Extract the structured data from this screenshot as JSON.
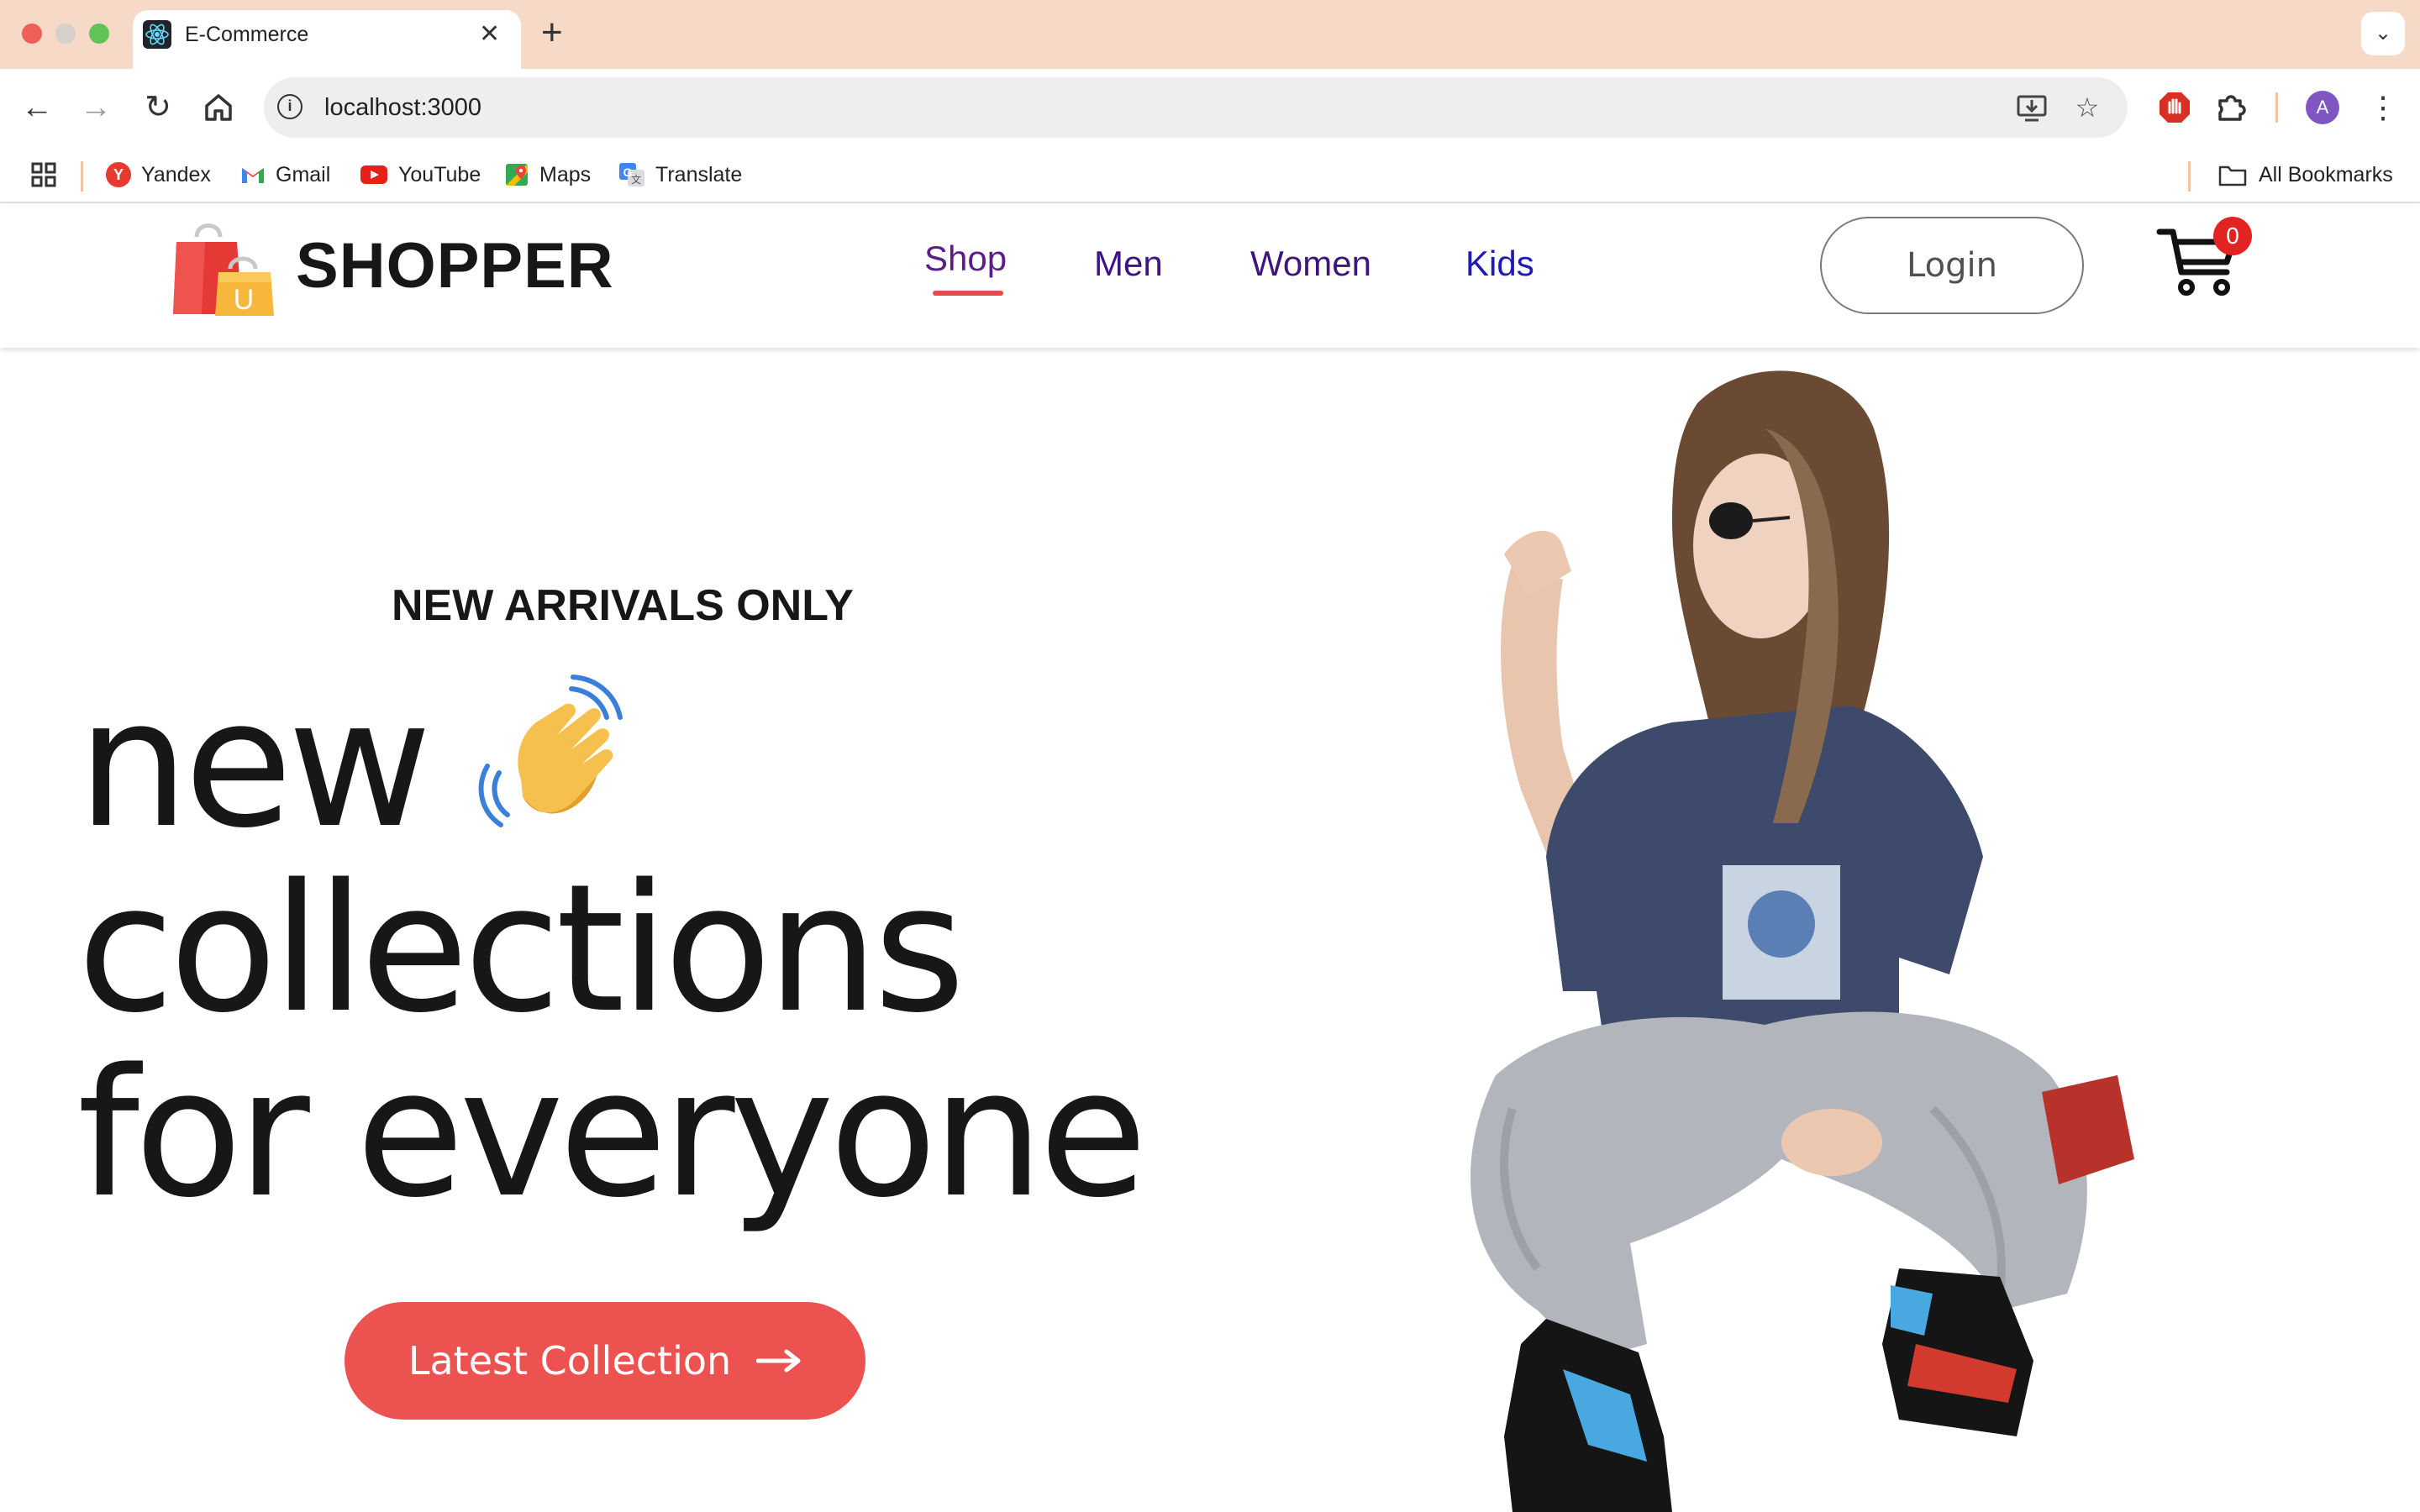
{
  "browser": {
    "tab_title": "E-Commerce",
    "tab_close": "✕",
    "new_tab": "+",
    "url": "localhost:3000",
    "bookmarks": [
      {
        "label": "Yandex",
        "icon": "yandex-icon",
        "color": "#e63a2e"
      },
      {
        "label": "Gmail",
        "icon": "gmail-icon",
        "color": "#ea4335"
      },
      {
        "label": "YouTube",
        "icon": "youtube-icon",
        "color": "#e62117"
      },
      {
        "label": "Maps",
        "icon": "maps-icon",
        "color": "#34a853"
      },
      {
        "label": "Translate",
        "icon": "translate-icon",
        "color": "#4285f4"
      }
    ],
    "all_bookmarks": "All Bookmarks",
    "avatar_letter": "A"
  },
  "site": {
    "logo_text": "SHOPPER",
    "menu": [
      {
        "label": "Shop",
        "active": true,
        "color": "#5b1d88"
      },
      {
        "label": "Men",
        "active": false,
        "color": "#3d1480"
      },
      {
        "label": "Women",
        "active": false,
        "color": "#3d1480"
      },
      {
        "label": "Kids",
        "active": false,
        "color": "#1e1ab3"
      }
    ],
    "login_label": "Login",
    "cart_count": "0"
  },
  "hero": {
    "kicker": "NEW ARRIVALS ONLY",
    "line1": "new",
    "line2": "collections",
    "line3": "for everyone",
    "cta_label": "Latest Collection",
    "accent_color": "#ec524f"
  }
}
